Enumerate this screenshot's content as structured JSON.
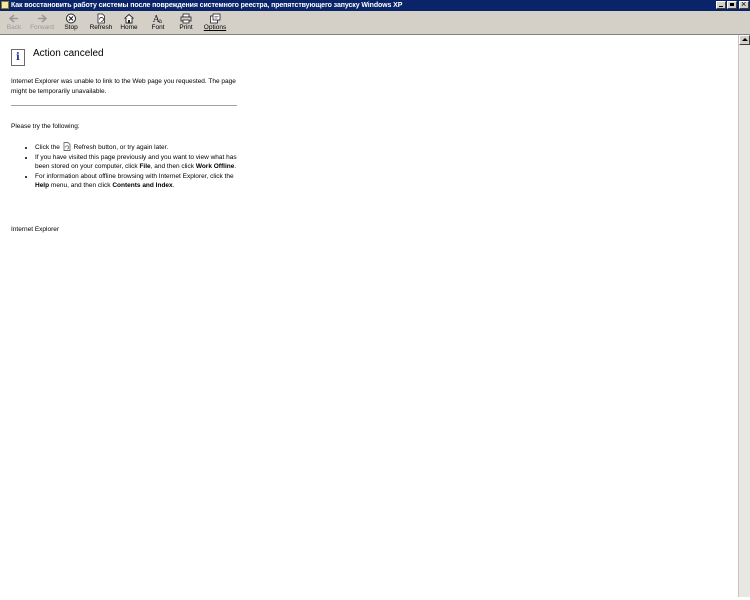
{
  "window": {
    "title": "Как восстановить работу системы после повреждения системного реестра, препятствующего запуску Windows XP"
  },
  "toolbar": {
    "buttons": [
      {
        "label": "Back",
        "icon": "back-arrow-icon",
        "disabled": true
      },
      {
        "label": "Forward",
        "icon": "forward-arrow-icon",
        "disabled": true
      },
      {
        "label": "Stop",
        "icon": "stop-icon",
        "disabled": false
      },
      {
        "label": "Refresh",
        "icon": "refresh-icon",
        "disabled": false
      },
      {
        "label": "Home",
        "icon": "home-icon",
        "disabled": false
      },
      {
        "label": "Font",
        "icon": "font-icon",
        "disabled": false
      },
      {
        "label": "Print",
        "icon": "printer-icon",
        "disabled": false
      },
      {
        "label": "Options",
        "icon": "options-icon",
        "disabled": false
      }
    ]
  },
  "page": {
    "heading": "Action canceled",
    "intro": "Internet Explorer was unable to link to the Web page you requested. The page might be temporarily unavailable.",
    "try_label": "Please try the following:",
    "items": {
      "refresh_pre": "Click the",
      "refresh_post": "Refresh button, or try again later.",
      "offline_pre": "If you have visited this page previously and you want to view what has been stored on your computer, click",
      "offline_file": "File",
      "offline_mid": ", and then click",
      "offline_work": "Work Offline",
      "offline_end": ".",
      "help_pre": "For information about offline browsing with Internet Explorer, click the",
      "help_menu": "Help",
      "help_mid": "menu, and then click",
      "help_contents": "Contents and Index",
      "help_end": "."
    },
    "footer": "Internet Explorer"
  },
  "colors": {
    "titlebar": "#0a246a",
    "toolbar": "#d4d0c8",
    "info_icon": "#1c2f8e"
  }
}
